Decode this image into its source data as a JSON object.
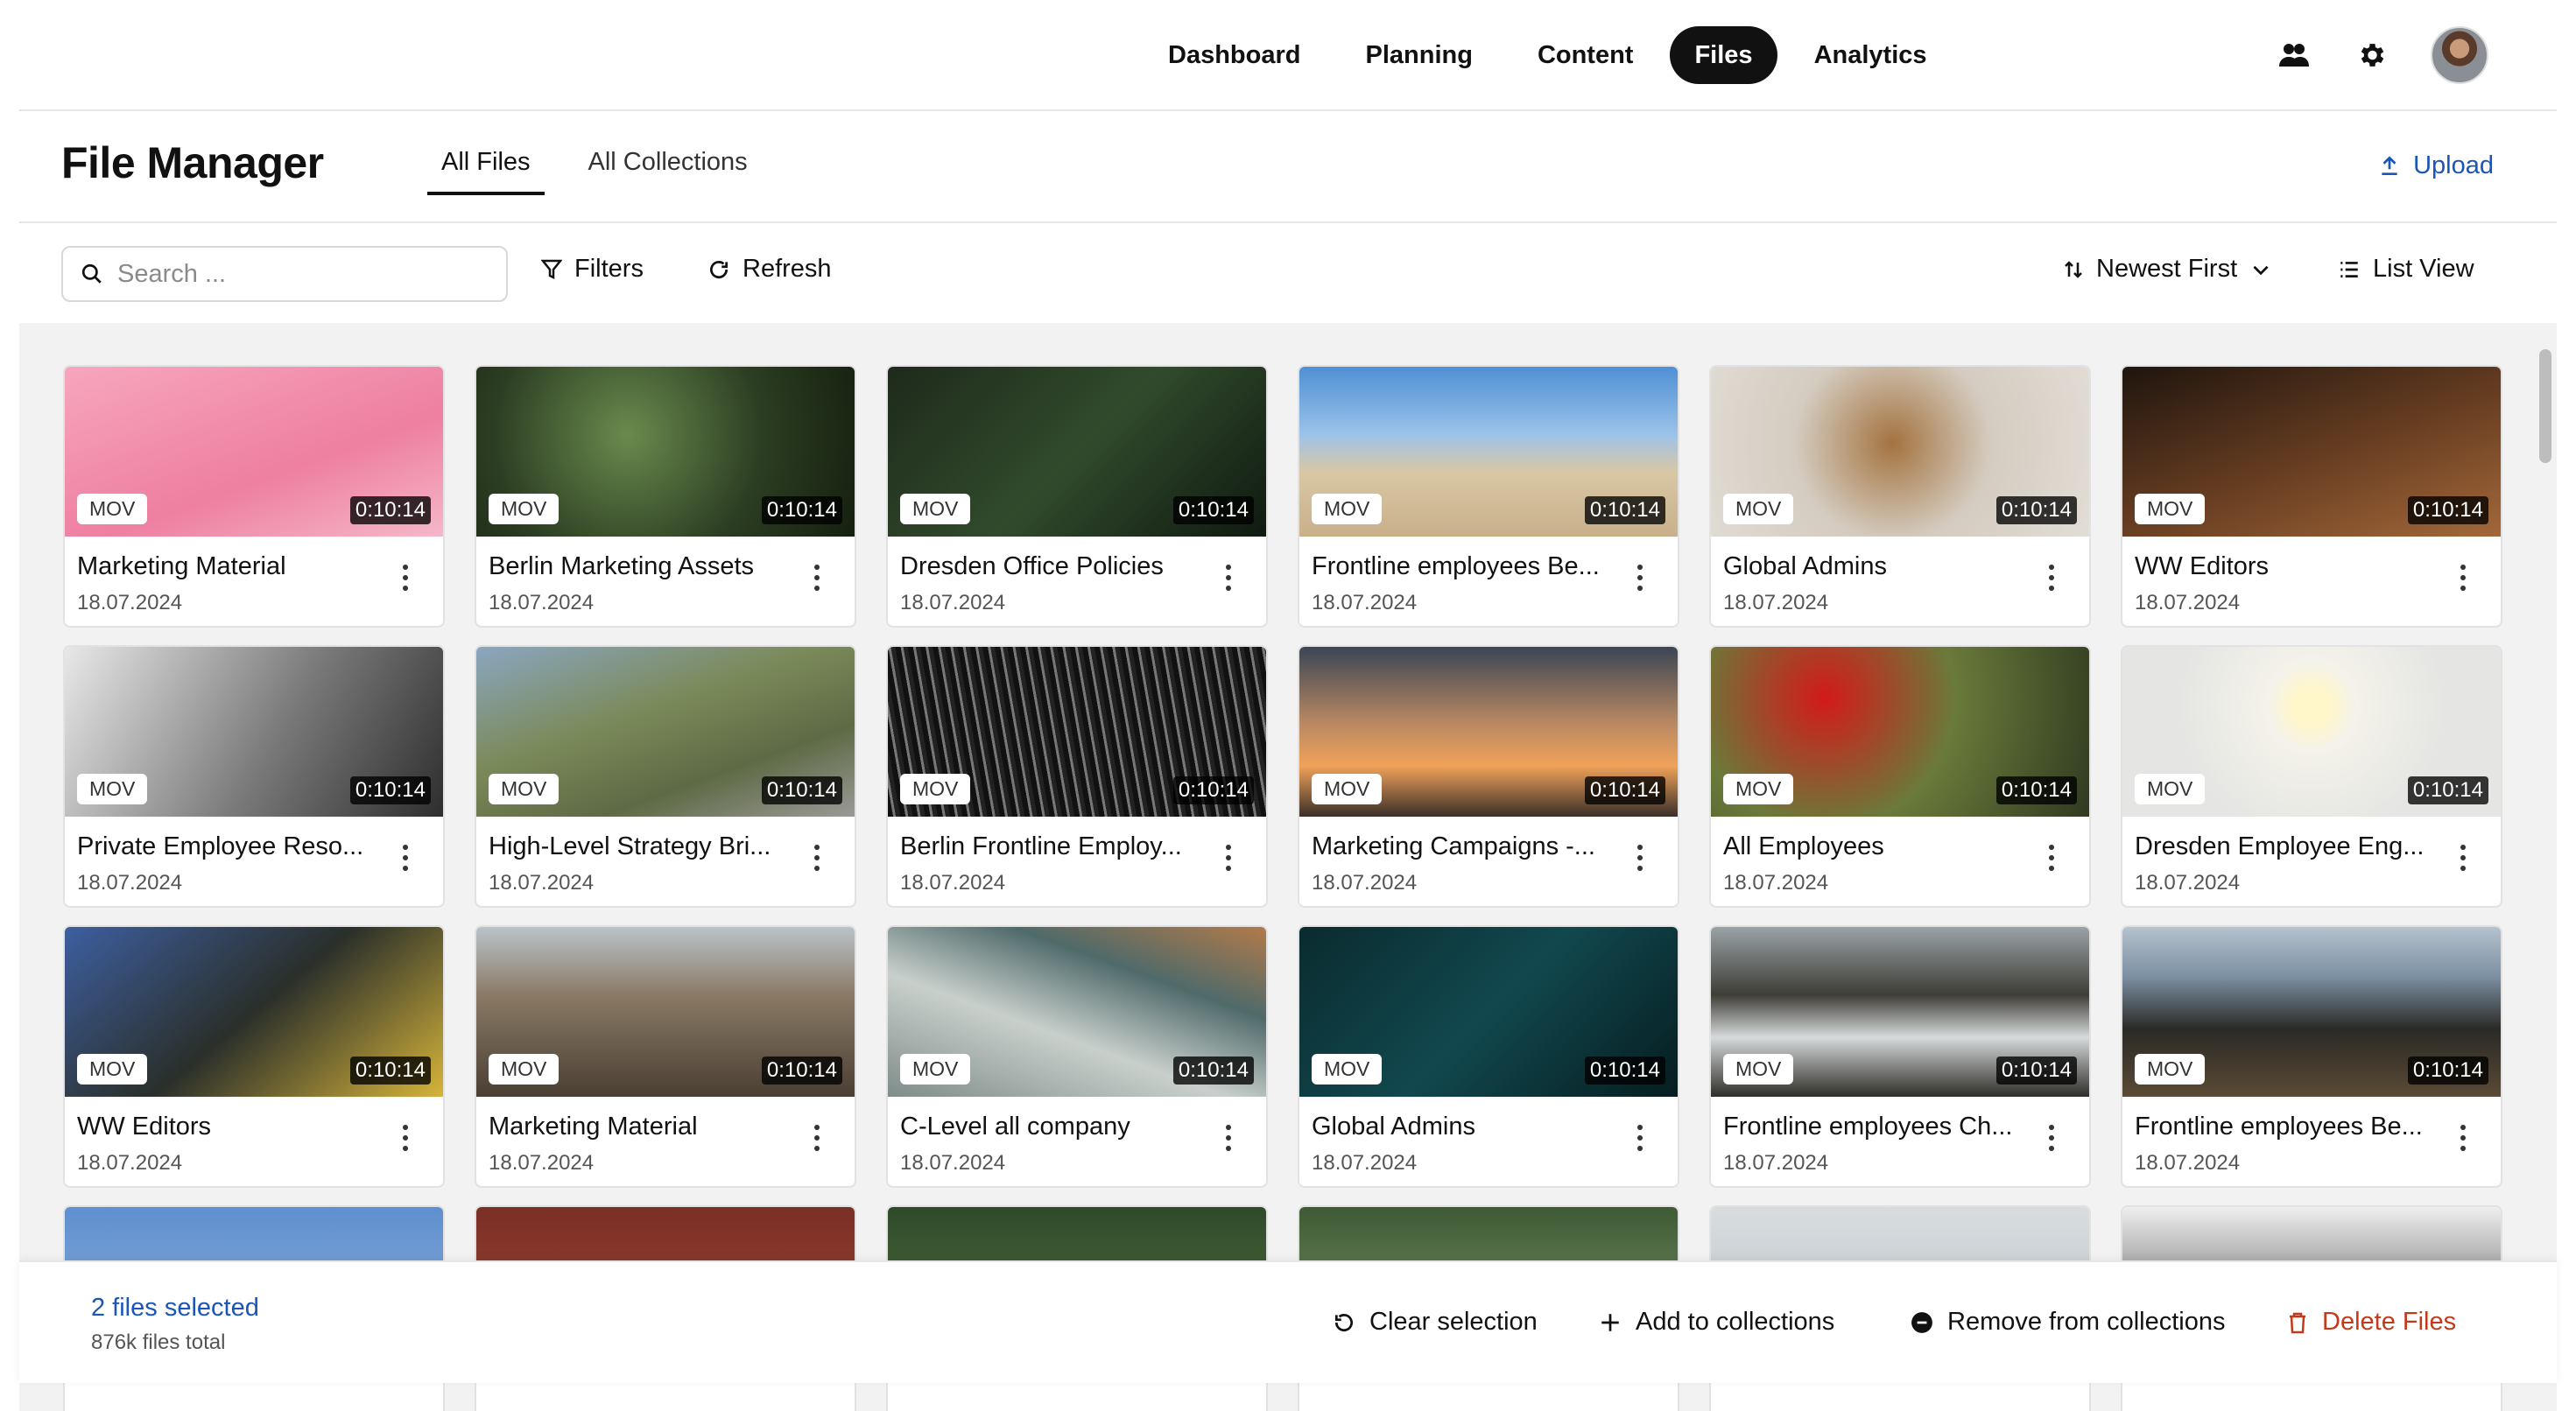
{
  "nav": {
    "links": [
      "Dashboard",
      "Planning",
      "Content",
      "Files",
      "Analytics"
    ],
    "active": "Files",
    "icons": [
      "users-icon",
      "gear-icon",
      "avatar"
    ]
  },
  "header": {
    "title": "File Manager",
    "tabs": [
      "All Files",
      "All Collections"
    ],
    "active_tab": "All Files",
    "upload_label": "Upload"
  },
  "toolbar": {
    "search_placeholder": "Search ...",
    "filters_label": "Filters",
    "refresh_label": "Refresh",
    "sort_label": "Newest First",
    "view_label": "List View"
  },
  "files": [
    {
      "name": "Marketing Material",
      "date": "18.07.2024",
      "type": "MOV",
      "duration": "0:10:14",
      "thumb": "linear-gradient(160deg,#f7a6be,#ee7fa1 60%,#f5b7c9)"
    },
    {
      "name": "Berlin Marketing Assets",
      "date": "18.07.2024",
      "type": "MOV",
      "duration": "0:10:14",
      "thumb": "radial-gradient(circle at 40% 40%,#6a8a4d,#2b3d22 55%,#15200f)"
    },
    {
      "name": "Dresden Office Policies",
      "date": "18.07.2024",
      "type": "MOV",
      "duration": "0:10:14",
      "thumb": "linear-gradient(135deg,#1e2a1b,#314a2c 50%,#0f1a10)"
    },
    {
      "name": "Frontline employees Be...",
      "date": "18.07.2024",
      "type": "MOV",
      "duration": "0:10:14",
      "thumb": "linear-gradient(180deg,#4f8fd4 0%,#9cc3ea 40%,#d9c7a5 62%,#c8b08a 100%)"
    },
    {
      "name": "Global Admins",
      "date": "18.07.2024",
      "type": "MOV",
      "duration": "0:10:14",
      "thumb": "radial-gradient(circle at 48% 45%,#a4733f,#d4ccc0 45%,#e2ddd6)"
    },
    {
      "name": "WW Editors",
      "date": "18.07.2024",
      "type": "MOV",
      "duration": "0:10:14",
      "thumb": "linear-gradient(160deg,#1f150e,#6a3f22 55%,#a3683a)"
    },
    {
      "name": "Private Employee Reso...",
      "date": "18.07.2024",
      "type": "MOV",
      "duration": "0:10:14",
      "thumb": "linear-gradient(120deg,#e8e8e8,#7a7a7a 55%,#2e2e2e)"
    },
    {
      "name": "High-Level Strategy Bri...",
      "date": "18.07.2024",
      "type": "MOV",
      "duration": "0:10:14",
      "thumb": "linear-gradient(160deg,#8aa6c0,#7b8a5a 40%,#5e6a45 70%,#9a9a96)"
    },
    {
      "name": "Berlin Frontline Employ...",
      "date": "18.07.2024",
      "type": "MOV",
      "duration": "0:10:14",
      "thumb": "repeating-linear-gradient(80deg,#111 0 6px,#777 6px 9px,#222 9px 14px)"
    },
    {
      "name": "Marketing Campaigns -...",
      "date": "18.07.2024",
      "type": "MOV",
      "duration": "0:10:14",
      "thumb": "linear-gradient(180deg,#3b4655,#b98862 45%,#f0a25a 70%,#3a2f28)"
    },
    {
      "name": "All Employees",
      "date": "18.07.2024",
      "type": "MOV",
      "duration": "0:10:14",
      "thumb": "radial-gradient(circle at 30% 30%,#d31a1a,#6a7a3a 45%,#2f3a20)"
    },
    {
      "name": "Dresden Employee Eng...",
      "date": "18.07.2024",
      "type": "MOV",
      "duration": "0:10:14",
      "thumb": "radial-gradient(circle at 50% 35%,#fff6c9 0 8%,#f4f2ea 20%,#e5e6e3 60%)"
    },
    {
      "name": "WW Editors",
      "date": "18.07.2024",
      "type": "MOV",
      "duration": "0:10:14",
      "thumb": "linear-gradient(140deg,#3d5fa0,#2a2f2a 50%,#d6b43a)"
    },
    {
      "name": "Marketing Material",
      "date": "18.07.2024",
      "type": "MOV",
      "duration": "0:10:14",
      "thumb": "linear-gradient(180deg,#b9c3c8,#8a7a66 40%,#4a3f33)"
    },
    {
      "name": "C-Level all company",
      "date": "18.07.2024",
      "type": "MOV",
      "duration": "0:10:14",
      "thumb": "linear-gradient(200deg,#b27a4a,#4f6a6a 30%,#c9d0cc 60%,#7f8c89)"
    },
    {
      "name": "Global Admins",
      "date": "18.07.2024",
      "type": "MOV",
      "duration": "0:10:14",
      "thumb": "linear-gradient(135deg,#0a2b2f,#11484e 50%,#061d20)"
    },
    {
      "name": "Frontline employees Ch...",
      "date": "18.07.2024",
      "type": "MOV",
      "duration": "0:10:14",
      "thumb": "linear-gradient(180deg,#9aa3a6,#3e3d36 40%,#d6dadb 65%,#2e2d27)"
    },
    {
      "name": "Frontline employees Be...",
      "date": "18.07.2024",
      "type": "MOV",
      "duration": "0:10:14",
      "thumb": "linear-gradient(180deg,#b6c3cf,#7a8da0 30%,#2a2a26 60%,#5b4a35)"
    },
    {
      "name": "",
      "date": "",
      "type": "",
      "duration": "",
      "thumb": "linear-gradient(180deg,#5e8fcf,#9ab8dc)"
    },
    {
      "name": "",
      "date": "",
      "type": "",
      "duration": "",
      "thumb": "linear-gradient(180deg,#7a2f25,#a74a3a)"
    },
    {
      "name": "",
      "date": "",
      "type": "",
      "duration": "",
      "thumb": "linear-gradient(180deg,#2e4a2a,#5d7a45)"
    },
    {
      "name": "",
      "date": "",
      "type": "",
      "duration": "",
      "thumb": "linear-gradient(180deg,#3e5a34,#8aa37a)"
    },
    {
      "name": "",
      "date": "",
      "type": "",
      "duration": "",
      "thumb": "linear-gradient(180deg,#d8dde0,#b6bcc0)"
    },
    {
      "name": "",
      "date": "",
      "type": "",
      "duration": "",
      "thumb": "linear-gradient(180deg,#eeeeee,#222)"
    }
  ],
  "selection": {
    "count_label": "2 files selected",
    "total_label": "876k files total",
    "clear_label": "Clear selection",
    "add_label": "Add to collections",
    "remove_label": "Remove from collections",
    "delete_label": "Delete Files"
  },
  "colors": {
    "accent": "#1a56b8",
    "danger": "#c23a1a",
    "nav_active_bg": "#111111"
  }
}
